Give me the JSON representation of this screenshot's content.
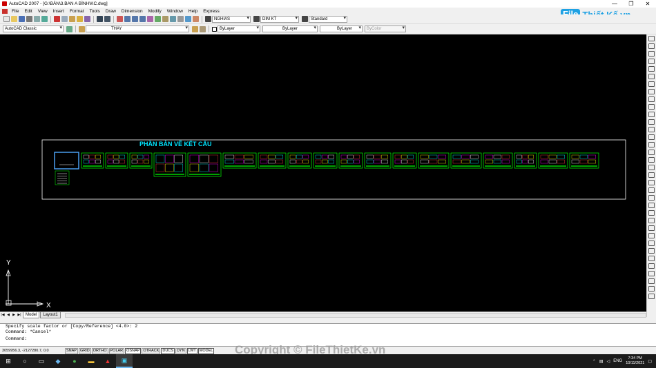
{
  "window": {
    "title": "AutoCAD 2007 - [G:\\BẢN\\3.BAN A BÌNH\\KC.dwg]",
    "minimize": "—",
    "restore": "❐",
    "close": "✕"
  },
  "menu": [
    "File",
    "Edit",
    "View",
    "Insert",
    "Format",
    "Tools",
    "Draw",
    "Dimension",
    "Modify",
    "Window",
    "Help",
    "Express"
  ],
  "toolbar1": {
    "text_style": "NGHIAS",
    "dim_style": "DIM KT",
    "table_style": "Standard"
  },
  "toolbar2": {
    "workspace": "AutoCAD Classic",
    "layer": "THAY",
    "color": "ByLayer",
    "linetype": "ByLayer",
    "lineweight": "ByLayer",
    "plotstyle": "ByColor"
  },
  "logo": {
    "box": "File",
    "text": "Thiết Kế.vn"
  },
  "drawing": {
    "heading": "PHẦN BẢN VẼ KẾT CẤU",
    "sheet_count": 18,
    "ucs_x": "X",
    "ucs_y": "Y"
  },
  "tabs": {
    "nav": [
      "|◀",
      "◀",
      "▶",
      "▶|"
    ],
    "model": "Model",
    "layout": "Layout1"
  },
  "command": {
    "line1": "Specify scale factor or [Copy/Reference] <4.0>: 2",
    "line2": "Command: *Cancel*",
    "line3": "Command:"
  },
  "status": {
    "coords": "3059956.3, -2127280.7, 0.0",
    "toggles": [
      "SNAP",
      "GRID",
      "ORTHO",
      "POLAR",
      "OSNAP",
      "OTRACK",
      "DUCS",
      "DYN",
      "LWT",
      "MODEL"
    ]
  },
  "watermark": "Copyright © FileThietKe.vn",
  "taskbar": {
    "lang": "ENG",
    "time": "7:34 PM",
    "date": "10/11/2021"
  },
  "colors": {
    "canvas": "#000000",
    "frame_green": "#00ff00",
    "heading_cyan": "#00e5ff",
    "border_white": "#ffffff",
    "logo_blue": "#1ea1e3"
  }
}
